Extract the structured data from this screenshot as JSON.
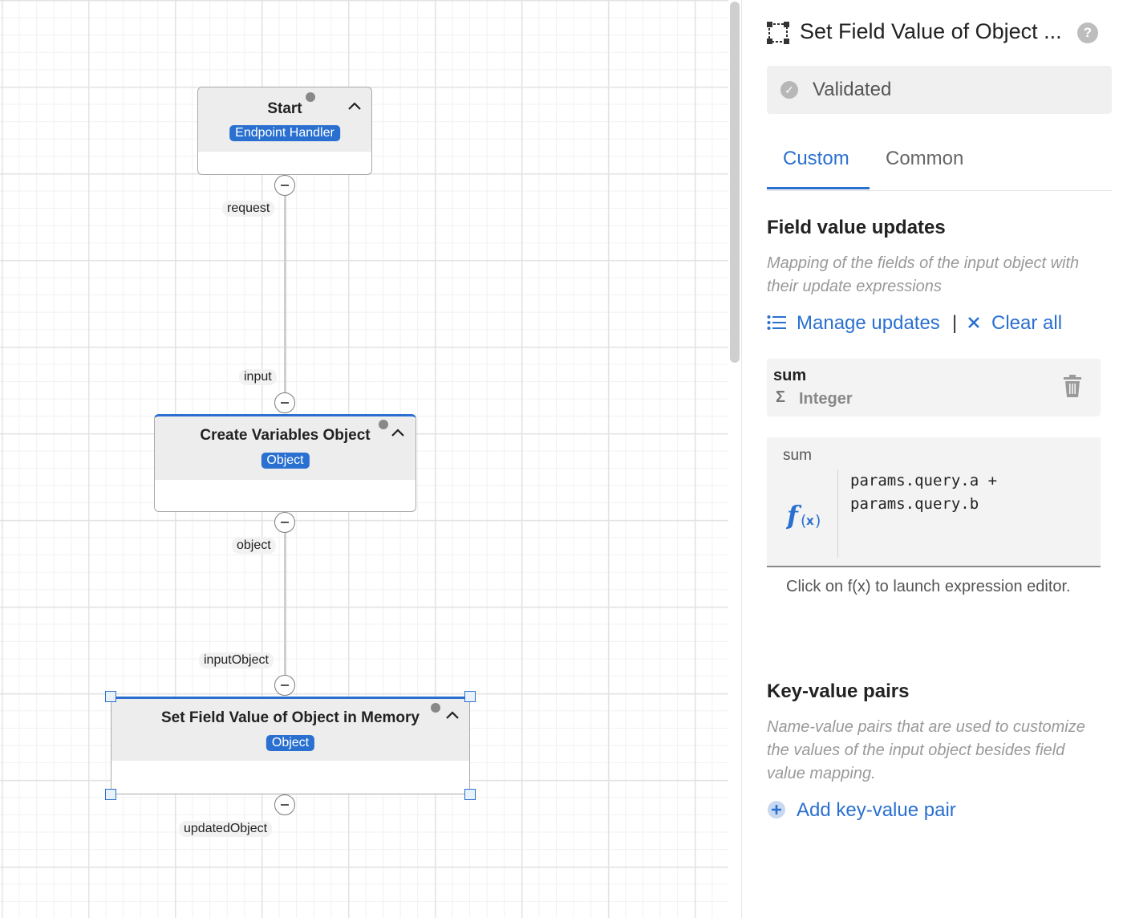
{
  "canvas": {
    "nodes": [
      {
        "title": "Start",
        "badge": "Endpoint Handler"
      },
      {
        "title": "Create Variables Object",
        "badge": "Object"
      },
      {
        "title": "Set Field Value of Object in Memory",
        "badge": "Object"
      }
    ],
    "port_labels": {
      "request": "request",
      "input": "input",
      "object": "object",
      "inputObject": "inputObject",
      "updatedObject": "updatedObject"
    }
  },
  "panel": {
    "title": "Set Field Value of Object ...",
    "help": "?",
    "status": "Validated",
    "tabs": [
      "Custom",
      "Common"
    ],
    "active_tab": "Custom",
    "field_updates": {
      "title": "Field value updates",
      "description": "Mapping of the fields of the input object with their update expressions",
      "manage_label": "Manage updates",
      "separator": "|",
      "clear_label": "Clear all",
      "field": {
        "name": "sum",
        "type_icon": "Σ",
        "type": "Integer"
      },
      "expression": {
        "label": "sum",
        "code": "params.query.a +\nparams.query.b"
      },
      "hint": "Click on f(x) to launch expression editor."
    },
    "key_value": {
      "title": "Key-value pairs",
      "description": "Name-value pairs that are used to customize the values of the input object besides field value mapping.",
      "add_label": "Add key-value pair"
    }
  },
  "colors": {
    "accent": "#2a70d0",
    "badge": "#2a70d0",
    "status_bg": "#f0f0f0"
  },
  "icons": [
    "node-transform-icon",
    "help-icon",
    "check-icon",
    "list-icon",
    "close-icon",
    "sigma-icon",
    "trash-icon",
    "fx-icon",
    "plus-circle-icon",
    "chevron-up-icon",
    "collapse-port-icon"
  ]
}
